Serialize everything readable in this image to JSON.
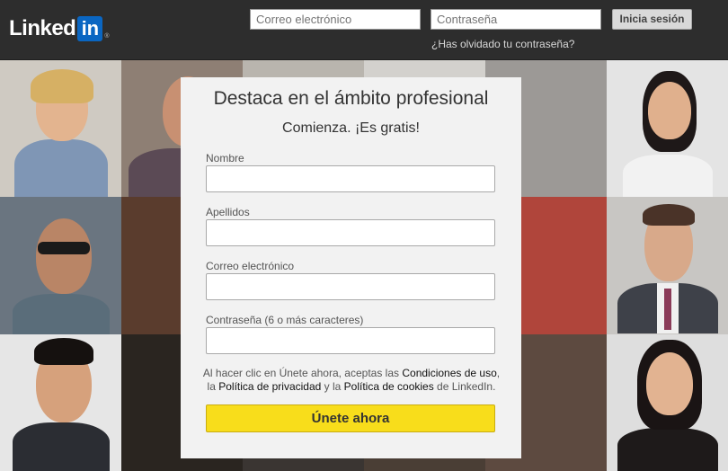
{
  "header": {
    "logo_text": "Linked",
    "logo_box": "in",
    "logo_reg": "®",
    "email_placeholder": "Correo electrónico",
    "password_placeholder": "Contraseña",
    "signin_label": "Inicia sesión",
    "forgot_label": "¿Has olvidado tu contraseña?"
  },
  "signup": {
    "title": "Destaca en el ámbito profesional",
    "subtitle": "Comienza. ¡Es gratis!",
    "first_name_label": "Nombre",
    "last_name_label": "Apellidos",
    "email_label": "Correo electrónico",
    "password_label": "Contraseña (6 o más caracteres)",
    "terms": {
      "t1": "Al hacer clic en Únete ahora, aceptas las ",
      "link_conditions": "Condiciones de uso",
      "t2": ",",
      "t3": "la ",
      "link_privacy": "Política de privacidad",
      "t4": " y la ",
      "link_cookies": "Política de cookies",
      "t5": " de LinkedIn."
    },
    "join_label": "Únete ahora"
  },
  "colors": {
    "header_bg": "#2d2d2d",
    "brand_blue": "#0a66c2",
    "panel_bg": "#f2f2f2",
    "join_button": "#f8dd1b"
  }
}
